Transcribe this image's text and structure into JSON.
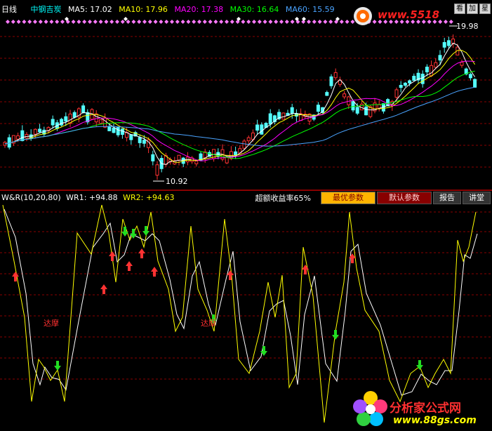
{
  "header": {
    "period": "日线",
    "stock_name": "中钢吉炭",
    "ma5": "MA5: 17.02",
    "ma10": "MA10: 17.96",
    "ma20": "MA20: 17.38",
    "ma30": "MA30: 16.64",
    "ma60": "MA60: 15.59",
    "corner_btn_1": "看",
    "corner_btn_2": "加",
    "corner_btn_3": "星"
  },
  "price_labels": {
    "high": "19.98",
    "low": "10.92"
  },
  "indicator": {
    "title": "W&R(10,20,80)",
    "wr1": "WR1: +94.88",
    "wr2": "WR2: +94.63",
    "yield_text": "超额收益率65%",
    "btn_optimal": "最优参数",
    "btn_default": "默认参数",
    "btn_report": "报告",
    "btn_explain": "讲堂"
  },
  "annotations": {
    "damo1": "达摩",
    "damo2": "达摩"
  },
  "watermarks": {
    "top": "www.5518",
    "bottom_name": "分析家公式网",
    "bottom_url": "www.88gs.com"
  },
  "colors": {
    "up": "#ff3232",
    "down": "#54ffff",
    "ma5": "#ffffff",
    "ma10": "#ffff00",
    "ma20": "#ff00ff",
    "ma30": "#00ff00",
    "ma60": "#4aa3ff",
    "wr1": "#ffffff",
    "wr2": "#ffff00",
    "grid": "#8a0000"
  }
}
